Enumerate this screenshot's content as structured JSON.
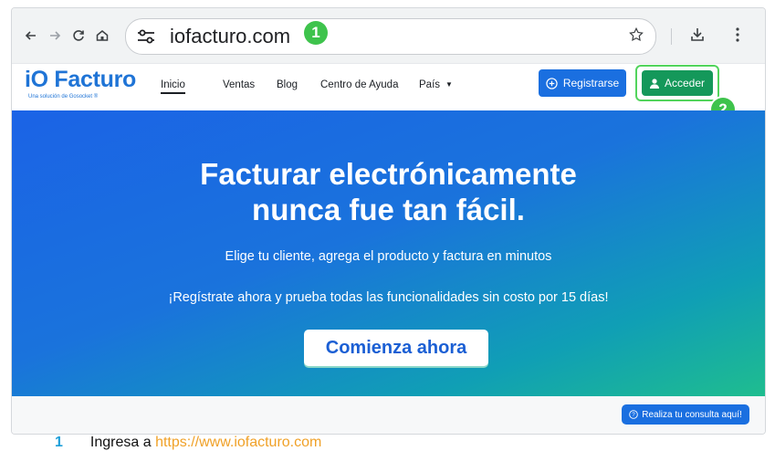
{
  "browser": {
    "url": "iofacturo.com",
    "step_badge_1": "1",
    "step_badge_2": "2"
  },
  "site": {
    "logo": "iO Facturo",
    "logo_tagline": "Una solución de Gosocket ®",
    "nav": [
      {
        "label": "Inicio"
      },
      {
        "label": "Ventas"
      },
      {
        "label": "Blog"
      },
      {
        "label": "Centro de Ayuda"
      },
      {
        "label": "País"
      }
    ],
    "register_label": "Registrarse",
    "login_label": "Acceder"
  },
  "hero": {
    "title_line1": "Facturar electrónicamente",
    "title_line2": "nunca fue tan fácil.",
    "subtitle": "Elige tu cliente, agrega el producto y factura en minutos",
    "promo": "¡Regístrate ahora y prueba todas las funcionalidades sin costo por 15 días!",
    "cta_label": "Comienza ahora"
  },
  "chat": {
    "label": "Realiza tu consulta aquí!"
  },
  "caption": {
    "number": "1",
    "text": "Ingresa a ",
    "link": "https://www.iofacturo.com"
  },
  "colors": {
    "accent": "#1a6fe0",
    "login": "#14985a",
    "badge": "#3ec34c"
  }
}
